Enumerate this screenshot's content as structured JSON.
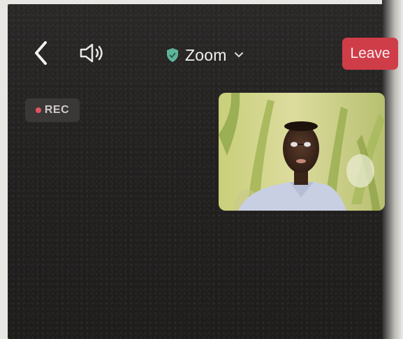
{
  "header": {
    "back_icon": "chevron-left-icon",
    "speaker_icon": "speaker-icon",
    "title": "Zoom",
    "security_icon": "shield-icon",
    "dropdown_icon": "chevron-down-icon",
    "leave_label": "Leave"
  },
  "recording": {
    "label": "REC"
  },
  "colors": {
    "leave_button": "#cf3d49",
    "shield": "#5fb49a",
    "rec_dot": "#e05561",
    "background": "#242221"
  }
}
